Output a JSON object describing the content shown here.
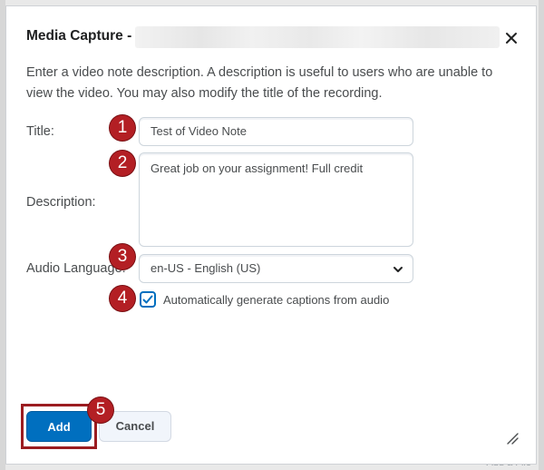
{
  "dialog": {
    "title": "Media Capture -",
    "close_label": "×"
  },
  "instructions": "Enter a video note description. A description is useful to users who are unable to view the video. You may also modify the title of the recording.",
  "form": {
    "title_label": "Title:",
    "title_value": "Test of Video Note",
    "description_label": "Description:",
    "description_value": "Great job on your assignment! Full credit",
    "audio_language_label": "Audio Language:",
    "audio_language_value": "en-US - English (US)",
    "captions_label": "Automatically generate captions from audio",
    "captions_checked": true
  },
  "buttons": {
    "add": "Add",
    "cancel": "Cancel"
  },
  "annotations": [
    "1",
    "2",
    "3",
    "4",
    "5"
  ],
  "background_text": "Add a File",
  "colors": {
    "primary": "#006fbf",
    "badge": "#b31f24",
    "highlight_outline": "#9b1c20"
  }
}
